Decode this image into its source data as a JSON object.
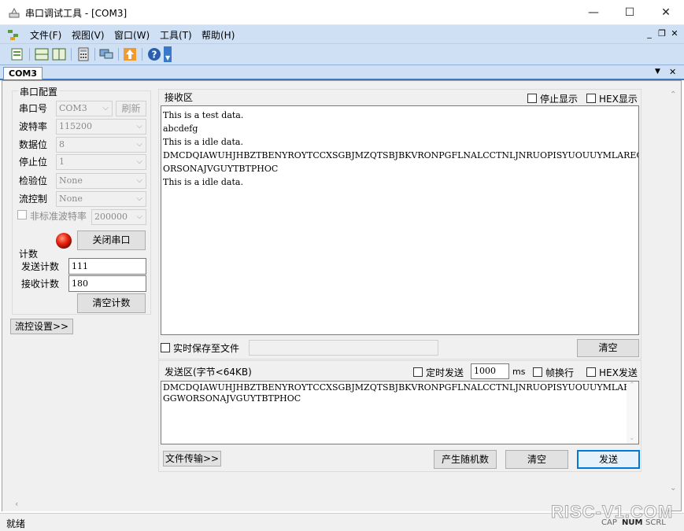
{
  "window": {
    "title": "串口调试工具 - [COM3]",
    "minimize": "—",
    "maximize": "☐",
    "close": "✕"
  },
  "menu": {
    "items": [
      "文件(F)",
      "视图(V)",
      "窗口(W)",
      "工具(T)",
      "帮助(H)"
    ],
    "mdi": {
      "minimize": "_",
      "restore": "❐",
      "close": "✕"
    }
  },
  "tab": {
    "label": "COM3",
    "dropdown": "▼",
    "close": "✕"
  },
  "serial_config": {
    "group_label": "串口配置",
    "port_label": "串口号",
    "port_value": "COM3",
    "refresh_label": "刷新",
    "baud_label": "波特率",
    "baud_value": "115200",
    "databits_label": "数据位",
    "databits_value": "8",
    "stopbits_label": "停止位",
    "stopbits_value": "1",
    "parity_label": "检验位",
    "parity_value": "None",
    "flow_label": "流控制",
    "flow_value": "None",
    "nonstd_label": "非标准波特率",
    "nonstd_value": "200000",
    "close_port_label": "关闭串口",
    "status_color": "#e8220f"
  },
  "counter": {
    "group_label": "计数",
    "send_label": "发送计数",
    "send_value": "111",
    "recv_label": "接收计数",
    "recv_value": "180",
    "clear_label": "清空计数"
  },
  "flow_settings_label": "流控设置>>",
  "receive": {
    "group_label": "接收区",
    "stop_display_label": "停止显示",
    "hex_display_label": "HEX显示",
    "lines": [
      "This is a test data.",
      "abcdefg",
      "This is a idle data.",
      "DMCDQIAWUHJHBZTBENYROYTCCXSGBJMZQTSBJBKVRONPGFLNALCCTNLJNRUOPISYUOUUYMLAREGABBIVJEIGGW",
      "ORSONAJVGUYTBTPHOC",
      "This is a idle data."
    ],
    "save_to_file_label": "实时保存至文件",
    "clear_label": "清空"
  },
  "send": {
    "group_label": "发送区(字节<64KB)",
    "timed_label": "定时发送",
    "interval_value": "1000",
    "interval_unit": "ms",
    "newline_label": "帧换行",
    "hex_send_label": "HEX发送",
    "lines": [
      "DMCDQIAWUHJHBZTBENYROYTCCXSGBJMZQTSBJBKVRONPGFLNALCCTNLJNRUOPISYUOUUYMLAREGABBIVJEI",
      "GGWORSONAJVGUYTBTPHOC"
    ],
    "file_transfer_label": "文件传输>>",
    "random_label": "产生随机数",
    "clear_label": "清空",
    "send_label": "发送"
  },
  "status": {
    "text": "就绪",
    "caps": "CAP",
    "num": "NUM",
    "scrl": "SCRL"
  },
  "watermark": "RISC-V1.COM",
  "colors": {
    "accent": "#0078d7",
    "menubar": "#cfe0f5",
    "tab_border": "#3a79c8"
  }
}
